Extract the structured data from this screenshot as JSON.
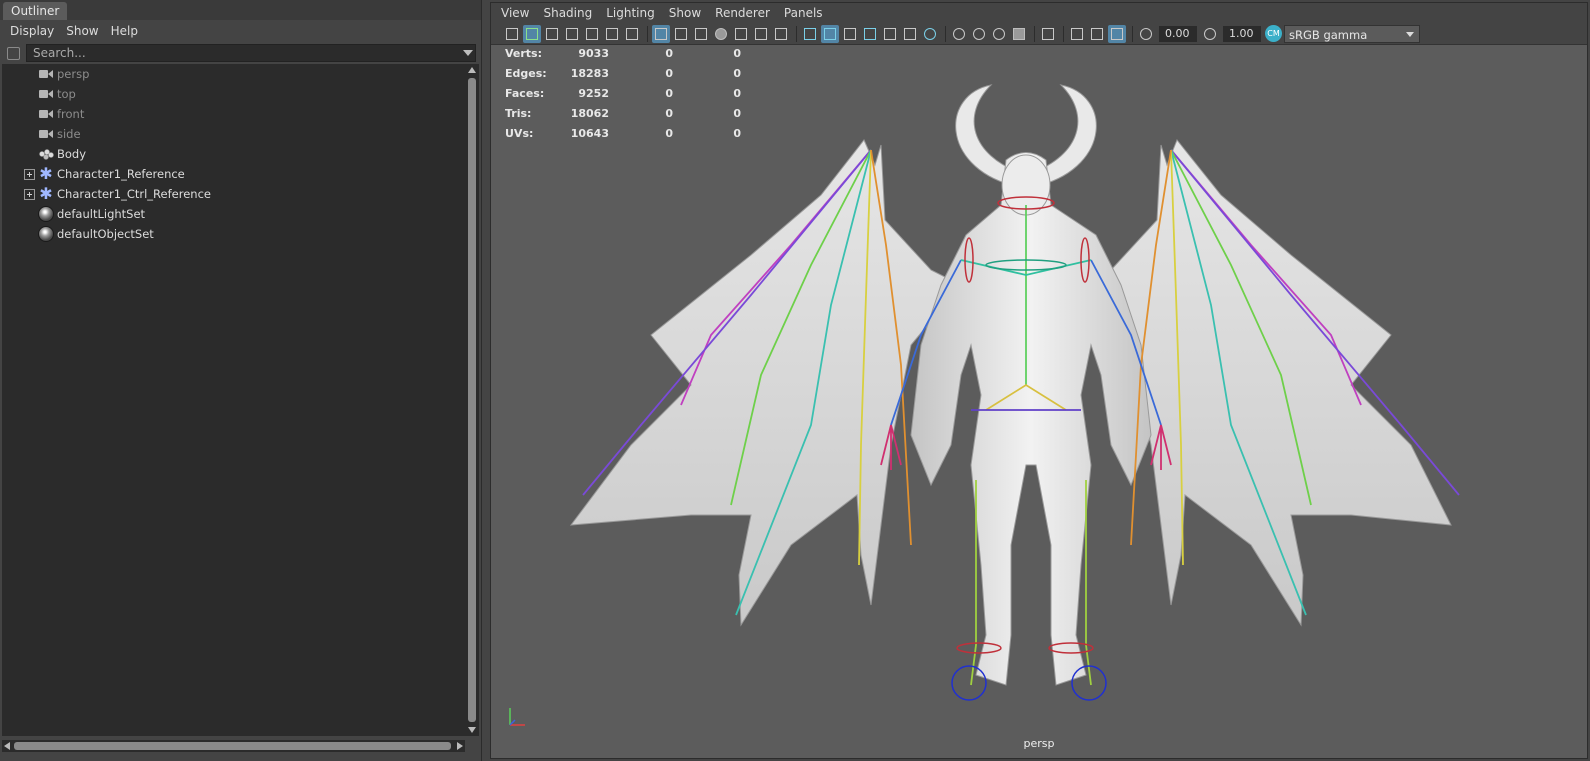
{
  "outliner": {
    "tab_title": "Outliner",
    "menu": [
      "Display",
      "Show",
      "Help"
    ],
    "search_placeholder": "Search...",
    "items": [
      {
        "label": "persp",
        "icon": "camera-icon",
        "dim": true,
        "expandable": false
      },
      {
        "label": "top",
        "icon": "camera-icon",
        "dim": true,
        "expandable": false
      },
      {
        "label": "front",
        "icon": "camera-icon",
        "dim": true,
        "expandable": false
      },
      {
        "label": "side",
        "icon": "camera-icon",
        "dim": true,
        "expandable": false
      },
      {
        "label": "Body",
        "icon": "mesh-icon",
        "dim": false,
        "expandable": false
      },
      {
        "label": "Character1_Reference",
        "icon": "reference-icon",
        "dim": false,
        "expandable": true
      },
      {
        "label": "Character1_Ctrl_Reference",
        "icon": "reference-icon",
        "dim": false,
        "expandable": true
      },
      {
        "label": "defaultLightSet",
        "icon": "set-icon",
        "dim": false,
        "expandable": false
      },
      {
        "label": "defaultObjectSet",
        "icon": "set-icon",
        "dim": false,
        "expandable": false
      }
    ]
  },
  "viewport": {
    "menu": [
      "View",
      "Shading",
      "Lighting",
      "Show",
      "Renderer",
      "Panels"
    ],
    "toolbar": {
      "exposure_value": "0.00",
      "gamma_value": "1.00",
      "color_space": "sRGB gamma"
    },
    "hud": [
      {
        "label": "Verts:",
        "values": [
          "9033",
          "0",
          "0"
        ]
      },
      {
        "label": "Edges:",
        "values": [
          "18283",
          "0",
          "0"
        ]
      },
      {
        "label": "Faces:",
        "values": [
          "9252",
          "0",
          "0"
        ]
      },
      {
        "label": "Tris:",
        "values": [
          "18062",
          "0",
          "0"
        ]
      },
      {
        "label": "UVs:",
        "values": [
          "10643",
          "0",
          "0"
        ]
      }
    ],
    "camera_name": "persp",
    "accent_color": "#5285a6",
    "background_color": "#5c5c5c"
  }
}
